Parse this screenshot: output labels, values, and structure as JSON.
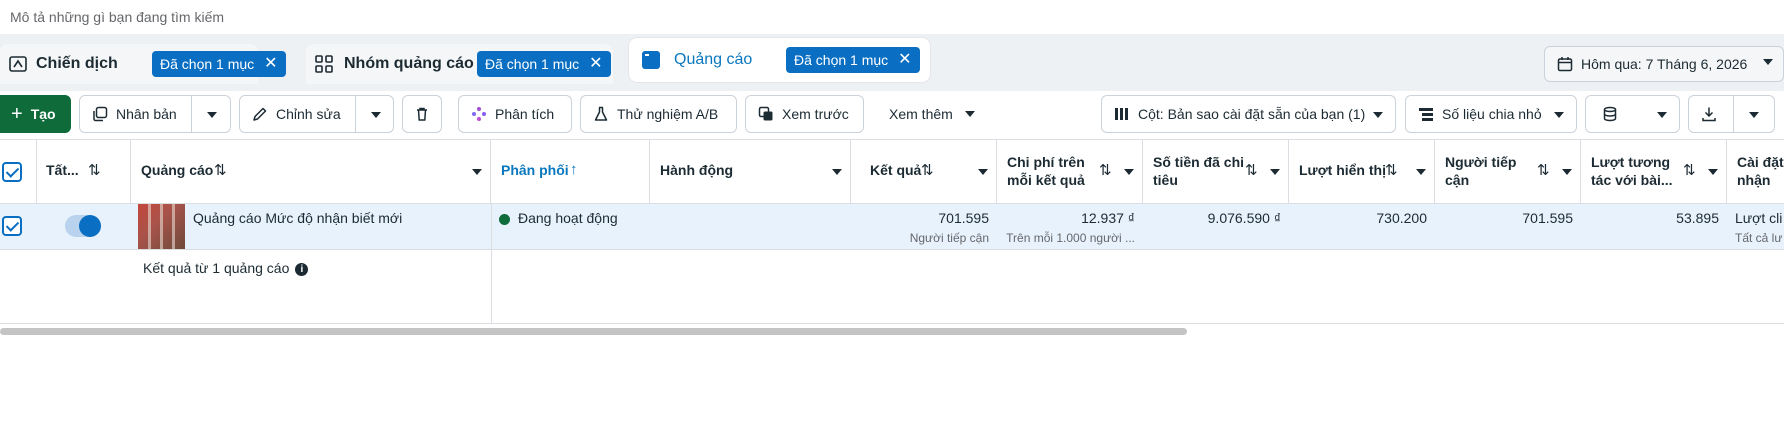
{
  "search": {
    "placeholder": "Mô tả những gì bạn đang tìm kiếm"
  },
  "tabs": [
    {
      "label": "Chiến dịch",
      "chip": "Đã chọn 1 mục"
    },
    {
      "label": "Nhóm quảng cáo",
      "chip": "Đã chọn 1 mục"
    },
    {
      "label": "Quảng cáo",
      "chip": "Đã chọn 1 mục"
    }
  ],
  "date_range": {
    "label": "Hôm qua: 7 Tháng 6, 2026"
  },
  "toolbar": {
    "create": "Tạo",
    "duplicate": "Nhân bản",
    "edit": "Chỉnh sửa",
    "analyze": "Phân tích",
    "ab_test": "Thử nghiệm A/B",
    "preview": "Xem trước",
    "more": "Xem thêm",
    "columns": "Cột: Bản sao cài đặt sẵn của bạn (1)",
    "breakdown": "Số liệu chia nhỏ"
  },
  "table": {
    "headers": {
      "all": "Tất...",
      "ad": "Quảng cáo",
      "delivery": "Phân phối",
      "actions": "Hành động",
      "results": "Kết quả",
      "cost_per_result": "Chi phí trên mỗi kết quả",
      "amount_spent": "Số tiền đã chi tiêu",
      "impressions": "Lượt hiển thị",
      "reach": "Người tiếp cận",
      "engagement": "Lượt tương tác với bài...",
      "settings": "Cài đặt nhận"
    },
    "row": {
      "ad_name": "Quảng cáo Mức độ nhận biết mới",
      "delivery": "Đang hoạt động",
      "results": "701.595",
      "results_sub": "Người tiếp cận",
      "cost_per_result": "12.937 ₫",
      "cost_per_result_sub": "Trên mỗi 1.000 người ...",
      "amount_spent": "9.076.590 ₫",
      "impressions": "730.200",
      "reach": "701.595",
      "engagement": "53.895",
      "settings": "Lượt cli",
      "settings_sub": "Tất cả lư"
    },
    "summary": "Kết quả từ 1 quảng cáo"
  },
  "colors": {
    "accent": "#0a6fc2",
    "create_green": "#0f6b3a",
    "active_tab_text": "#0a78be"
  }
}
